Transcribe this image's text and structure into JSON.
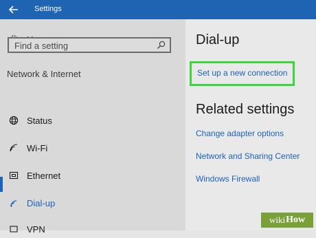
{
  "window": {
    "title": "Settings"
  },
  "sidebar": {
    "home_label": "Home",
    "search_placeholder": "Find a setting",
    "section_header": "Network & Internet",
    "items": [
      {
        "label": "Status",
        "icon": "globe-icon"
      },
      {
        "label": "Wi-Fi",
        "icon": "wifi-icon"
      },
      {
        "label": "Ethernet",
        "icon": "ethernet-icon"
      },
      {
        "label": "Dial-up",
        "icon": "dialup-icon",
        "active": true
      },
      {
        "label": "VPN",
        "icon": "vpn-icon"
      }
    ]
  },
  "main": {
    "title": "Dial-up",
    "setup_link": "Set up a new connection",
    "related_title": "Related settings",
    "related_links": [
      "Change adapter options",
      "Network and Sharing Center",
      "Windows Firewall"
    ]
  },
  "watermark": {
    "left": "wiki",
    "right": "How"
  },
  "colors": {
    "titlebar": "#1f63b3",
    "link": "#1a63b6",
    "highlight": "#3bd63b",
    "watermark": "#7aa03a"
  }
}
